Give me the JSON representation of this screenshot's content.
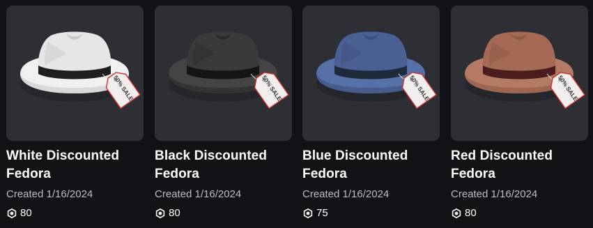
{
  "items": [
    {
      "name": "White Discounted Fedora",
      "created": "Created 1/16/2024",
      "price": "80",
      "icon": "robux-icon",
      "colors": {
        "crown": "#e6e6e6",
        "crown_shade": "#c9c9c9",
        "brim": "#f0f0f0",
        "band": "#1e1e1e"
      }
    },
    {
      "name": "Black Discounted Fedora",
      "created": "Created 1/16/2024",
      "price": "80",
      "icon": "robux-icon",
      "colors": {
        "crown": "#3a3a3a",
        "crown_shade": "#2a2a2a",
        "brim": "#444444",
        "band": "#141414"
      }
    },
    {
      "name": "Blue Discounted Fedora",
      "created": "Created 1/16/2024",
      "price": "75",
      "icon": "robux-icon",
      "colors": {
        "crown": "#4a5f93",
        "crown_shade": "#3d4f7c",
        "brim": "#5670a8",
        "band": "#1d2a3a"
      }
    },
    {
      "name": "Red Discounted Fedora",
      "created": "Created 1/16/2024",
      "price": "80",
      "icon": "robux-icon",
      "colors": {
        "crown": "#a56a55",
        "crown_shade": "#8e5846",
        "brim": "#b57a63",
        "band": "#4a1c1e"
      }
    }
  ],
  "tag": {
    "text": "50% SALE!",
    "bg": "#f3eeee",
    "stroke": "#c9302c"
  }
}
